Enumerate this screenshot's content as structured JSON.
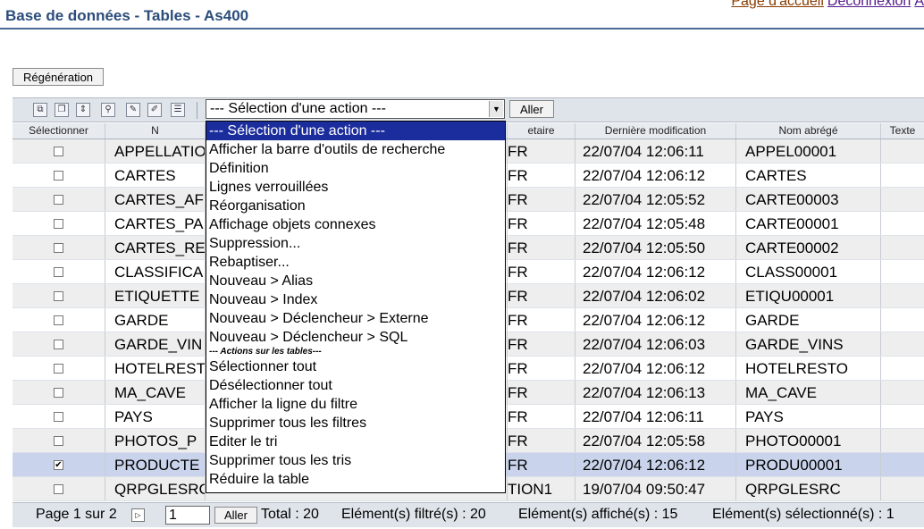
{
  "header": {
    "title": "Base de données - Tables - As400",
    "links": [
      "Page d'accueil",
      "Déconnexion",
      "A"
    ]
  },
  "regen_button": "Régénération",
  "toolbar": {
    "icons": [
      "copy-icon",
      "paste-icon",
      "move-icon",
      "filter-icon",
      "edit-icon",
      "edit-alt-icon",
      "properties-icon"
    ],
    "select_value": "--- Sélection d'une action ---",
    "go_label": "Aller"
  },
  "columns": [
    "Sélectionner",
    "N",
    "",
    "etaire",
    "Dernière modification",
    "Nom abrégé",
    "Texte"
  ],
  "rows": [
    {
      "name": "APPELLATIO",
      "owner": "FR",
      "modified": "22/07/04 12:06:11",
      "short": "APPEL00001",
      "selected": false
    },
    {
      "name": "CARTES",
      "owner": "FR",
      "modified": "22/07/04 12:06:12",
      "short": "CARTES",
      "selected": false
    },
    {
      "name": "CARTES_AF",
      "owner": "FR",
      "modified": "22/07/04 12:05:52",
      "short": "CARTE00003",
      "selected": false
    },
    {
      "name": "CARTES_PA",
      "owner": "FR",
      "modified": "22/07/04 12:05:48",
      "short": "CARTE00001",
      "selected": false
    },
    {
      "name": "CARTES_RE",
      "owner": "FR",
      "modified": "22/07/04 12:05:50",
      "short": "CARTE00002",
      "selected": false
    },
    {
      "name": "CLASSIFICA",
      "owner": "FR",
      "modified": "22/07/04 12:06:12",
      "short": "CLASS00001",
      "selected": false
    },
    {
      "name": "ETIQUETTE",
      "owner": "FR",
      "modified": "22/07/04 12:06:02",
      "short": "ETIQU00001",
      "selected": false
    },
    {
      "name": "GARDE",
      "owner": "FR",
      "modified": "22/07/04 12:06:12",
      "short": "GARDE",
      "selected": false
    },
    {
      "name": "GARDE_VIN",
      "owner": "FR",
      "modified": "22/07/04 12:06:03",
      "short": "GARDE_VINS",
      "selected": false
    },
    {
      "name": "HOTELREST",
      "owner": "FR",
      "modified": "22/07/04 12:06:12",
      "short": "HOTELRESTO",
      "selected": false
    },
    {
      "name": "MA_CAVE",
      "owner": "FR",
      "modified": "22/07/04 12:06:13",
      "short": "MA_CAVE",
      "selected": false
    },
    {
      "name": "PAYS",
      "owner": "FR",
      "modified": "22/07/04 12:06:11",
      "short": "PAYS",
      "selected": false
    },
    {
      "name": "PHOTOS_P",
      "owner": "FR",
      "modified": "22/07/04 12:05:58",
      "short": "PHOTO00001",
      "selected": false
    },
    {
      "name": "PRODUCTE",
      "owner": "FR",
      "modified": "22/07/04 12:06:12",
      "short": "PRODU00001",
      "selected": true
    },
    {
      "name": "QRPGLESRC",
      "owner": "TION1",
      "modified": "19/07/04 09:50:47",
      "short": "QRPGLESRC",
      "selected": false
    }
  ],
  "dropdown": {
    "items": [
      "--- Sélection d'une action ---",
      "Afficher la barre d'outils de recherche",
      "Définition",
      "Lignes verrouillées",
      "Réorganisation",
      "Affichage objets connexes",
      "Suppression...",
      "Rebaptiser...",
      "Nouveau > Alias",
      "Nouveau > Index",
      "Nouveau > Déclencheur > Externe",
      "Nouveau > Déclencheur > SQL"
    ],
    "group_label": "--- Actions sur les tables---",
    "group_items": [
      "Sélectionner tout",
      "Désélectionner tout",
      "Afficher la ligne du filtre",
      "Supprimer tous les filtres",
      "Editer le tri",
      "Supprimer tous les tris",
      "Réduire la table"
    ]
  },
  "footer": {
    "page_text": "Page 1 sur 2",
    "page_input": "1",
    "go_label": "Aller",
    "total": "Total : 20",
    "filtered": "Elément(s) filtré(s) : 20",
    "shown": "Elément(s) affiché(s) : 15",
    "selected": "Elément(s) sélectionné(s) : 1"
  },
  "colors": {
    "title": "#2b4d7a",
    "selected_row": "#c9d4ec",
    "dropdown_highlight": "#1b2d9c"
  }
}
